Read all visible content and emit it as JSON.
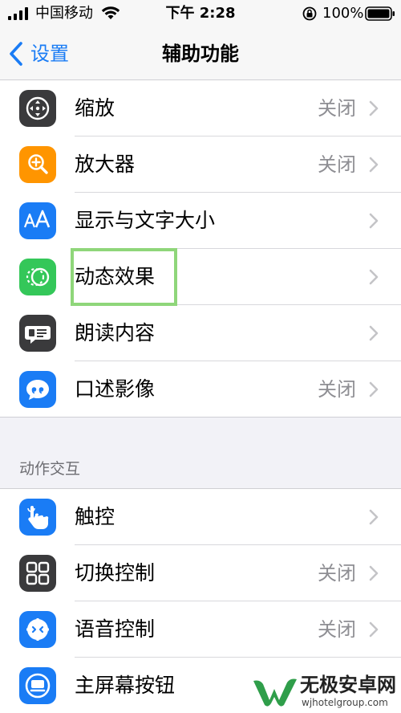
{
  "status_bar": {
    "carrier": "中国移动",
    "time": "下午 2:28",
    "battery_percent": "100%"
  },
  "nav": {
    "back_label": "设置",
    "title": "辅助功能"
  },
  "rows_group1": [
    {
      "label": "缩放",
      "value": "关闭",
      "icon": "zoom-icon",
      "icon_color": "#3a3a3c"
    },
    {
      "label": "放大器",
      "value": "关闭",
      "icon": "magnifier-icon",
      "icon_color": "#ff9500"
    },
    {
      "label": "显示与文字大小",
      "value": "",
      "icon": "text-size-icon",
      "icon_color": "#1a7cf5"
    },
    {
      "label": "动态效果",
      "value": "",
      "icon": "motion-icon",
      "icon_color": "#34c759"
    },
    {
      "label": "朗读内容",
      "value": "",
      "icon": "spoken-content-icon",
      "icon_color": "#3a3a3c"
    },
    {
      "label": "口述影像",
      "value": "关闭",
      "icon": "audio-description-icon",
      "icon_color": "#1a7cf5"
    }
  ],
  "section_header": "动作交互",
  "rows_group2": [
    {
      "label": "触控",
      "value": "",
      "icon": "touch-icon",
      "icon_color": "#1a7cf5"
    },
    {
      "label": "切换控制",
      "value": "关闭",
      "icon": "switch-control-icon",
      "icon_color": "#3a3a3c"
    },
    {
      "label": "语音控制",
      "value": "关闭",
      "icon": "voice-control-icon",
      "icon_color": "#1a7cf5"
    },
    {
      "label": "主屏幕按钮",
      "value": "",
      "icon": "home-button-icon",
      "icon_color": "#1a7cf5"
    }
  ],
  "watermark": {
    "title": "无极安卓网",
    "url": "wjhotelgroup.com"
  },
  "colors": {
    "accent": "#1a7cf5",
    "highlight": "#8fd67a"
  }
}
